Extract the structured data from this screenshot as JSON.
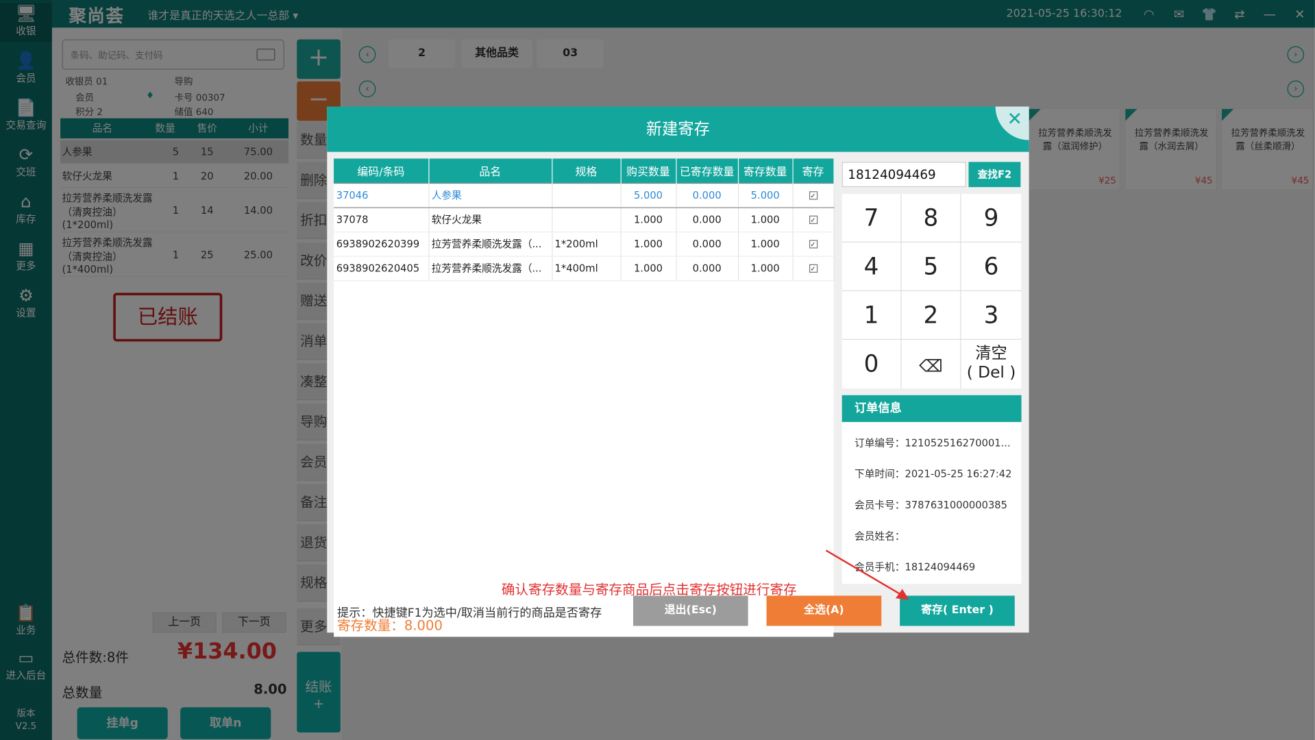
{
  "topbar": {
    "logo": "聚尚荟",
    "store": "谁才是真正的天选之人一总部",
    "dropdown_icon": "chevron-down-icon",
    "datetime": "2021-05-25 16:30:12",
    "icons": [
      "wifi-icon",
      "message-icon",
      "shirt-icon",
      "swap-icon",
      "minimize-icon",
      "close-icon"
    ]
  },
  "sidebar": {
    "items": [
      {
        "label": "收银",
        "icon": "monitor-icon"
      },
      {
        "label": "会员",
        "icon": "user-icon"
      },
      {
        "label": "交易查询",
        "icon": "document-icon"
      },
      {
        "label": "交班",
        "icon": "handover-icon"
      },
      {
        "label": "库存",
        "icon": "warehouse-icon"
      },
      {
        "label": "更多",
        "icon": "grid-icon"
      },
      {
        "label": "设置",
        "icon": "gear-icon"
      },
      {
        "label": "业务",
        "icon": "clipboard-icon"
      },
      {
        "label": "进入后台",
        "icon": "desktop-icon"
      }
    ],
    "version_label": "版本",
    "version": "V2.5"
  },
  "left": {
    "search_placeholder": "条码、助记码、支付码",
    "cashier_label": "收银员",
    "cashier": "01",
    "guide_label": "导购",
    "member_label": "会员",
    "card_label": "卡号",
    "card": "00307",
    "points_label": "积分",
    "points": "2",
    "balance_label": "储值",
    "balance": "640",
    "columns": [
      "品名",
      "数量",
      "售价",
      "小计"
    ],
    "rows": [
      {
        "name": "人参果",
        "qty": "5",
        "price": "15",
        "subtotal": "75.00"
      },
      {
        "name": "软仔火龙果",
        "qty": "1",
        "price": "20",
        "subtotal": "20.00"
      },
      {
        "name": "拉芳营养柔顺洗发露（清爽控油）(1*200ml)",
        "qty": "1",
        "price": "14",
        "subtotal": "14.00"
      },
      {
        "name": "拉芳营养柔顺洗发露（清爽控油）(1*400ml)",
        "qty": "1",
        "price": "25",
        "subtotal": "25.00"
      }
    ],
    "stamp": "已结账",
    "prev_page": "上一页",
    "next_page": "下一页",
    "total_items": "总件数:8件",
    "total_price": "¥134.00",
    "total_qty_label": "总数量",
    "total_qty": "8.00",
    "hold_button": "挂单g",
    "retrieve_button": "取单n"
  },
  "middle": {
    "plus": "+",
    "minus": "−",
    "ops": [
      "数量",
      "删除",
      "折扣",
      "改价",
      "赠送",
      "消单",
      "凑整",
      "导购",
      "会员",
      "备注",
      "退货",
      "规格",
      "更多"
    ],
    "checkout": "结账",
    "checkout_sub": "+"
  },
  "right": {
    "tabs": [
      "2",
      "其他品类",
      "03"
    ],
    "products": [
      {
        "name": "拉芳营养柔顺洗发露（滋润修护）",
        "price": "¥25"
      },
      {
        "name": "拉芳营养柔顺洗发露（水润去屑）",
        "price": "¥45"
      },
      {
        "name": "拉芳营养柔顺洗发露（丝柔顺滑）",
        "price": "¥45"
      }
    ]
  },
  "modal": {
    "title": "新建寄存",
    "columns": [
      "编码/条码",
      "品名",
      "规格",
      "购买数量",
      "已寄存数量",
      "寄存数量",
      "寄存"
    ],
    "rows": [
      {
        "code": "37046",
        "name": "人参果",
        "spec": "",
        "buy": "5.000",
        "stored": "0.000",
        "store": "5.000",
        "check": "✓"
      },
      {
        "code": "37078",
        "name": "软仔火龙果",
        "spec": "",
        "buy": "1.000",
        "stored": "0.000",
        "store": "1.000",
        "check": "✓"
      },
      {
        "code": "6938902620399",
        "name": "拉芳营养柔顺洗发露（...",
        "spec": "1*200ml",
        "buy": "1.000",
        "stored": "0.000",
        "store": "1.000",
        "check": "✓"
      },
      {
        "code": "6938902620405",
        "name": "拉芳营养柔顺洗发露（...",
        "spec": "1*400ml",
        "buy": "1.000",
        "stored": "0.000",
        "store": "1.000",
        "check": "✓"
      }
    ],
    "tip_red": "确认寄存数量与寄存商品后点击寄存按钮进行寄存",
    "store_count": "寄存数量：8.000",
    "hint": "提示：快捷键F1为选中/取消当前行的商品是否寄存",
    "exit_button": "退出(Esc)",
    "select_all_button": "全选(A)",
    "store_button": "寄存( Enter )",
    "phone_value": "18124094469",
    "find_button": "查找F2",
    "keys": [
      "7",
      "8",
      "9",
      "4",
      "5",
      "6",
      "1",
      "2",
      "3",
      "0"
    ],
    "clear_key": "清空",
    "clear_key_sub": "( Del )",
    "order_info_title": "订单信息",
    "order_no": "订单编号：121052516270001...",
    "order_time": "下单时间：2021-05-25 16:27:42",
    "member_card": "会员卡号：3787631000000385",
    "member_name": "会员姓名：",
    "member_phone": "会员手机：18124094469",
    "colors": {
      "primary": "#12a69c",
      "orange": "#ef7d36",
      "gray": "#9c9c9c",
      "red": "#e23131"
    }
  }
}
